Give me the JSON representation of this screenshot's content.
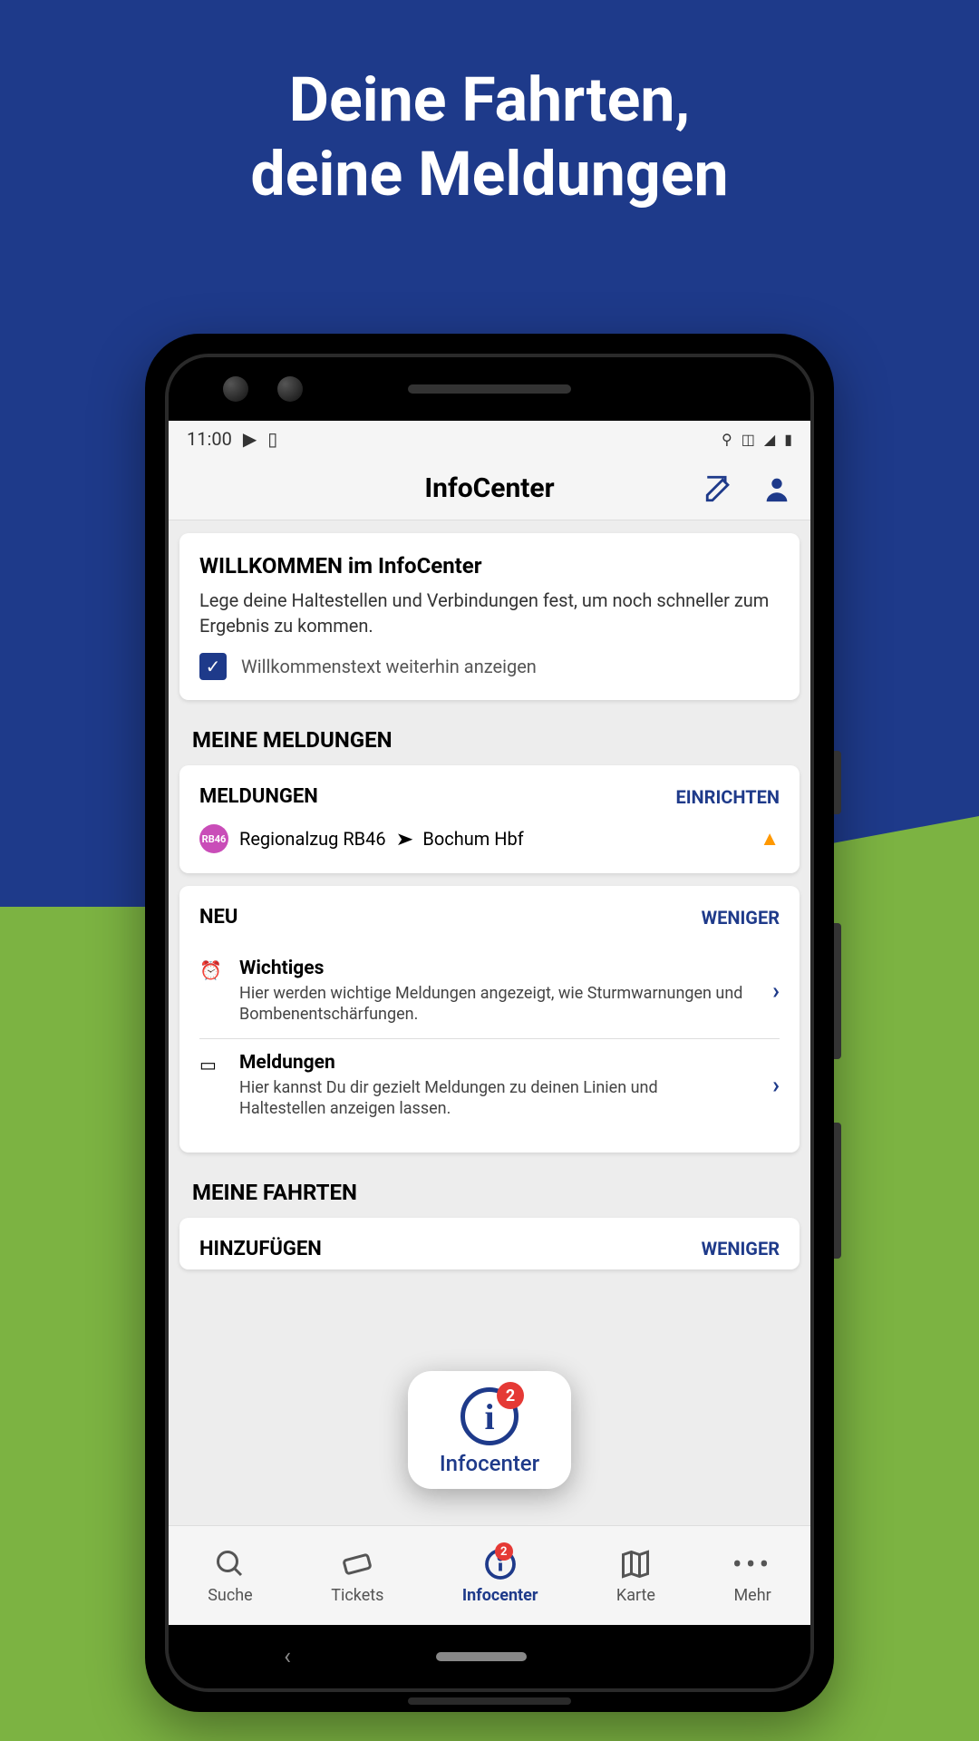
{
  "hero": {
    "line1": "Deine Fahrten,",
    "line2": "deine Meldungen"
  },
  "statusbar": {
    "time": "11:00"
  },
  "header": {
    "title": "InfoCenter"
  },
  "welcome": {
    "title": "WILLKOMMEN im InfoCenter",
    "text": "Lege deine Haltestellen und Verbindungen fest, um noch schneller zum Ergebnis zu kommen.",
    "checkbox_label": "Willkommenstext weiterhin anzeigen"
  },
  "sections": {
    "meldungen_title": "MEINE MELDUNGEN",
    "fahrten_title": "MEINE FAHRTEN"
  },
  "meldungen_card": {
    "title": "MELDUNGEN",
    "action": "EINRICHTEN",
    "line_badge": "RB46",
    "line_text": "Regionalzug RB46",
    "destination": "Bochum Hbf"
  },
  "neu_card": {
    "title": "NEU",
    "action": "WENIGER",
    "items": [
      {
        "title": "Wichtiges",
        "desc": "Hier werden wichtige Meldungen angezeigt, wie Sturmwarnungen und Bombenentschärfungen."
      },
      {
        "title": "Meldungen",
        "desc": "Hier kannst Du dir gezielt Meldungen zu deinen Linien und Haltestellen anzeigen lassen."
      }
    ]
  },
  "hinzufuegen_card": {
    "title": "HINZUFÜGEN",
    "action": "WENIGER"
  },
  "floating": {
    "label": "Infocenter",
    "badge": "2"
  },
  "nav": {
    "items": [
      {
        "label": "Suche"
      },
      {
        "label": "Tickets"
      },
      {
        "label": "Infocenter",
        "badge": "2"
      },
      {
        "label": "Karte"
      },
      {
        "label": "Mehr"
      }
    ]
  }
}
